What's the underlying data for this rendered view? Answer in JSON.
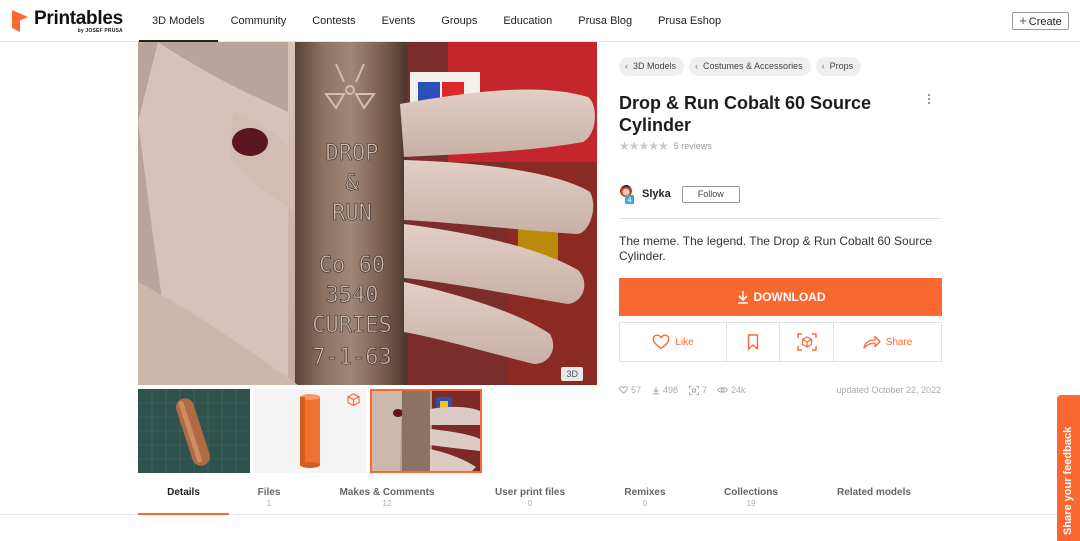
{
  "brand": {
    "name": "Printables",
    "sub": "by JOSEF PRUSA",
    "accent": "#fa6831"
  },
  "nav": {
    "items": [
      "3D Models",
      "Community",
      "Contests",
      "Events",
      "Groups",
      "Education",
      "Prusa Blog",
      "Prusa Eshop"
    ],
    "active": "3D Models",
    "create_label": "Create"
  },
  "gallery": {
    "badge_3d": "3D",
    "main_image_stamp": [
      "DROP",
      "&",
      "RUN",
      "Co 60",
      "3540",
      "CURIES",
      "7-1-63"
    ],
    "thumbnails": [
      "photo of orange cylinder on cutting mat",
      "3D render of orange cylinder",
      "photo of stamped cylinder held in hand"
    ],
    "selected_thumbnail": 3
  },
  "breadcrumbs": [
    "3D Models",
    "Costumes & Accessories",
    "Props"
  ],
  "model": {
    "title": "Drop & Run Cobalt 60 Source Cylinder",
    "rating_stars": 0,
    "reviews_label": "5 reviews",
    "author": "Slyka",
    "follow_label": "Follow",
    "description": "The meme. The legend. The Drop & Run Cobalt 60 Source Cylinder.",
    "download_label": "DOWNLOAD"
  },
  "actions": {
    "like": "Like",
    "share": "Share"
  },
  "stats": {
    "likes": "57",
    "downloads": "498",
    "makes": "7",
    "views": "24k",
    "updated": "updated October 22, 2022"
  },
  "tabs": [
    {
      "label": "Details",
      "count": ""
    },
    {
      "label": "Files",
      "count": "1"
    },
    {
      "label": "Makes & Comments",
      "count": "12"
    },
    {
      "label": "User print files",
      "count": "0"
    },
    {
      "label": "Remixes",
      "count": "0"
    },
    {
      "label": "Collections",
      "count": "19"
    },
    {
      "label": "Related models",
      "count": ""
    }
  ],
  "feedback_label": "Share your feedback"
}
